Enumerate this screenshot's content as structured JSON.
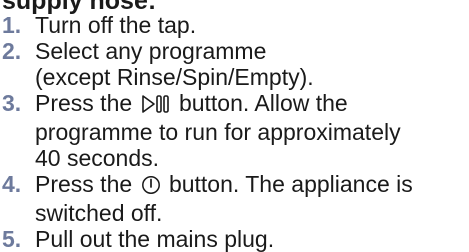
{
  "heading": "supply hose:",
  "steps": [
    {
      "number": "1.",
      "text": "Turn off the tap."
    },
    {
      "number": "2.",
      "text": "Select any programme\n(except Rinse/Spin/Empty)."
    },
    {
      "number": "3.",
      "before_icon": "Press the",
      "icon": "start-pause-icon",
      "after_icon": "button. Allow the\nprogramme to run for approximately\n40 seconds."
    },
    {
      "number": "4.",
      "before_icon": "Press the",
      "icon": "power-icon",
      "after_icon": "button. The appliance is\nswitched off."
    },
    {
      "number": "5.",
      "text": "Pull out the mains plug."
    }
  ],
  "colors": {
    "step_number": "#6d7a9c",
    "text": "#1a1a1a"
  }
}
